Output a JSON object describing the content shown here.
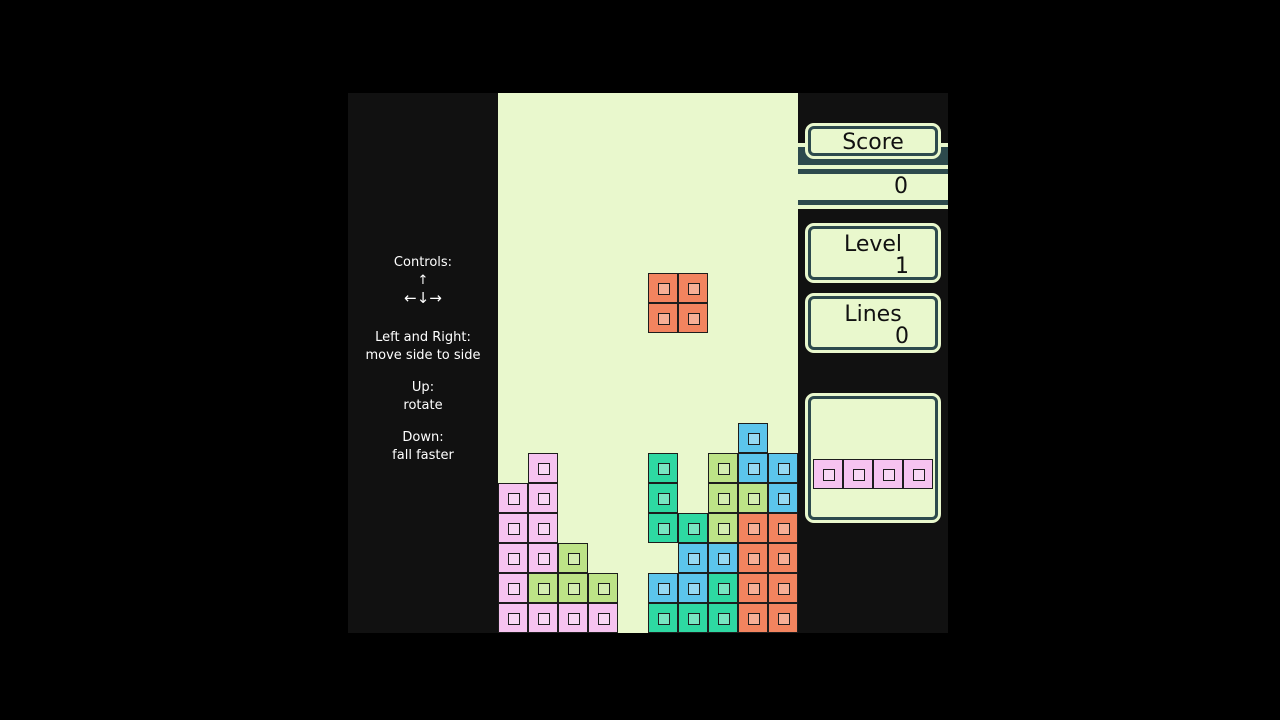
{
  "controls": {
    "heading": "Controls:",
    "arrow_up": "↑",
    "arrows_row": "←↓→",
    "left_right_title": "Left and Right:",
    "left_right_desc": "move side to side",
    "up_title": "Up:",
    "up_desc": "rotate",
    "down_title": "Down:",
    "down_desc": "fall faster"
  },
  "stats": {
    "score_label": "Score",
    "score_value": "0",
    "level_label": "Level",
    "level_value": "1",
    "lines_label": "Lines",
    "lines_value": "0"
  },
  "colors": {
    "board_bg": "#e9f8cd",
    "panel_border": "#2d4a4d",
    "pink": "#f6c3f0",
    "green": "#bde387",
    "teal": "#2ed8a2",
    "blue": "#5cc5ec",
    "orange": "#f2845f"
  },
  "board": {
    "columns": 10,
    "rows": 18,
    "falling_piece": {
      "type": "O",
      "color": "orange",
      "cells": [
        [
          5,
          6
        ],
        [
          6,
          6
        ],
        [
          5,
          7
        ],
        [
          6,
          7
        ]
      ]
    },
    "locked": [
      {
        "col": 1,
        "row": 12,
        "color": "pink"
      },
      {
        "col": 0,
        "row": 13,
        "color": "pink"
      },
      {
        "col": 1,
        "row": 13,
        "color": "pink"
      },
      {
        "col": 0,
        "row": 14,
        "color": "pink"
      },
      {
        "col": 1,
        "row": 14,
        "color": "pink"
      },
      {
        "col": 0,
        "row": 15,
        "color": "pink"
      },
      {
        "col": 1,
        "row": 15,
        "color": "pink"
      },
      {
        "col": 2,
        "row": 15,
        "color": "green"
      },
      {
        "col": 0,
        "row": 16,
        "color": "pink"
      },
      {
        "col": 1,
        "row": 16,
        "color": "green"
      },
      {
        "col": 2,
        "row": 16,
        "color": "green"
      },
      {
        "col": 3,
        "row": 16,
        "color": "green"
      },
      {
        "col": 0,
        "row": 17,
        "color": "pink"
      },
      {
        "col": 1,
        "row": 17,
        "color": "pink"
      },
      {
        "col": 2,
        "row": 17,
        "color": "pink"
      },
      {
        "col": 3,
        "row": 17,
        "color": "pink"
      },
      {
        "col": 8,
        "row": 11,
        "color": "blue"
      },
      {
        "col": 5,
        "row": 12,
        "color": "teal"
      },
      {
        "col": 7,
        "row": 12,
        "color": "green"
      },
      {
        "col": 8,
        "row": 12,
        "color": "blue"
      },
      {
        "col": 9,
        "row": 12,
        "color": "blue"
      },
      {
        "col": 5,
        "row": 13,
        "color": "teal"
      },
      {
        "col": 7,
        "row": 13,
        "color": "green"
      },
      {
        "col": 8,
        "row": 13,
        "color": "green"
      },
      {
        "col": 9,
        "row": 13,
        "color": "blue"
      },
      {
        "col": 5,
        "row": 14,
        "color": "teal"
      },
      {
        "col": 6,
        "row": 14,
        "color": "teal"
      },
      {
        "col": 7,
        "row": 14,
        "color": "green"
      },
      {
        "col": 8,
        "row": 14,
        "color": "orange"
      },
      {
        "col": 9,
        "row": 14,
        "color": "orange"
      },
      {
        "col": 6,
        "row": 15,
        "color": "blue"
      },
      {
        "col": 7,
        "row": 15,
        "color": "blue"
      },
      {
        "col": 8,
        "row": 15,
        "color": "orange"
      },
      {
        "col": 9,
        "row": 15,
        "color": "orange"
      },
      {
        "col": 5,
        "row": 16,
        "color": "blue"
      },
      {
        "col": 6,
        "row": 16,
        "color": "blue"
      },
      {
        "col": 7,
        "row": 16,
        "color": "teal"
      },
      {
        "col": 8,
        "row": 16,
        "color": "orange"
      },
      {
        "col": 9,
        "row": 16,
        "color": "orange"
      },
      {
        "col": 5,
        "row": 17,
        "color": "teal"
      },
      {
        "col": 6,
        "row": 17,
        "color": "teal"
      },
      {
        "col": 7,
        "row": 17,
        "color": "teal"
      },
      {
        "col": 8,
        "row": 17,
        "color": "orange"
      },
      {
        "col": 9,
        "row": 17,
        "color": "orange"
      }
    ]
  },
  "next_piece": {
    "type": "I",
    "color": "pink",
    "cells": 4
  }
}
